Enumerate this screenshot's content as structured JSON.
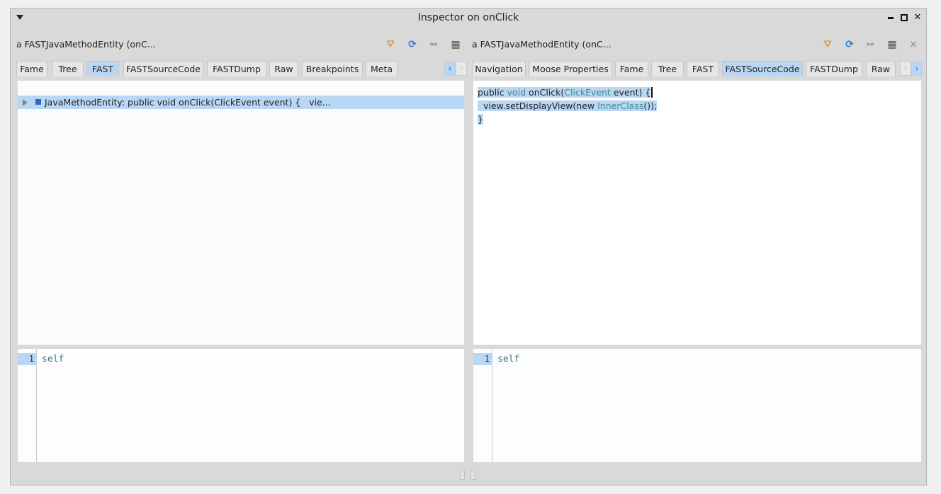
{
  "window": {
    "title": "Inspector on onClick"
  },
  "left_pane": {
    "object_title": "a FASTJavaMethodEntity (onC...",
    "tabs": [
      {
        "label": "Fame",
        "active": false
      },
      {
        "label": "Tree",
        "active": false
      },
      {
        "label": "FAST",
        "active": true
      },
      {
        "label": "FASTSourceCode",
        "active": false
      },
      {
        "label": "FASTDump",
        "active": false
      },
      {
        "label": "Raw",
        "active": false
      },
      {
        "label": "Breakpoints",
        "active": false
      },
      {
        "label": "Meta",
        "active": false
      }
    ],
    "tree_row": {
      "text": "JavaMethodEntity: public void onClick(ClickEvent event) {   vie..."
    },
    "evaluator": {
      "line_number": "1",
      "code": "self"
    }
  },
  "right_pane": {
    "object_title": "a FASTJavaMethodEntity (onC...",
    "tabs": [
      {
        "label": "Navigation",
        "active": false
      },
      {
        "label": "Moose Properties",
        "active": false
      },
      {
        "label": "Fame",
        "active": false
      },
      {
        "label": "Tree",
        "active": false
      },
      {
        "label": "FAST",
        "active": false
      },
      {
        "label": "FASTSourceCode",
        "active": true
      },
      {
        "label": "FASTDump",
        "active": false
      },
      {
        "label": "Raw",
        "active": false
      }
    ],
    "source": {
      "l1_kw1": "public",
      "l1_kw2": "void",
      "l1_name": "onClick(",
      "l1_type": "ClickEvent",
      "l1_rest": " event) {",
      "l2_a": "  view.setDisplayView(new ",
      "l2_cls": "InnerClass",
      "l2_b": "());",
      "l3": "}"
    },
    "evaluator": {
      "line_number": "1",
      "code": "self"
    }
  },
  "icons": {
    "tab_scroll_left": "‹",
    "tab_scroll_right": "›",
    "close": "×"
  }
}
